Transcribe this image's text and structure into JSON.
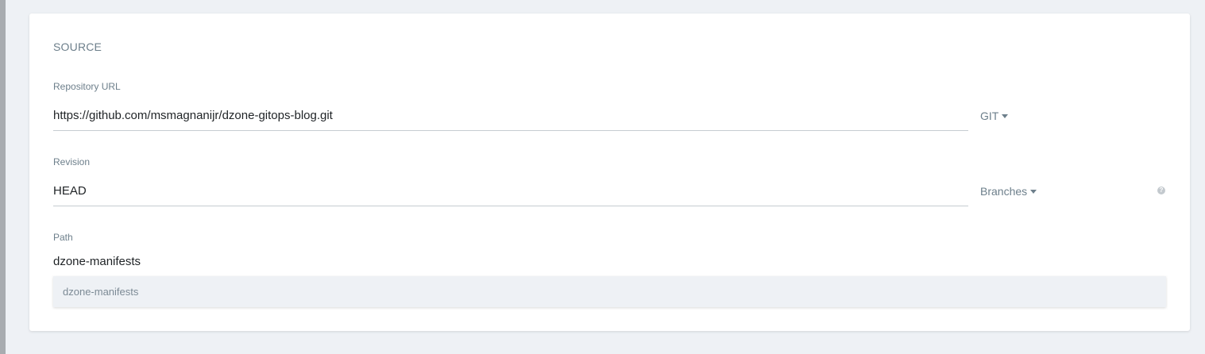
{
  "source": {
    "title": "SOURCE",
    "repository_url": {
      "label": "Repository URL",
      "value": "https://github.com/msmagnanijr/dzone-gitops-blog.git",
      "type_dropdown": "GIT"
    },
    "revision": {
      "label": "Revision",
      "value": "HEAD",
      "type_dropdown": "Branches",
      "help_icon": "?"
    },
    "path": {
      "label": "Path",
      "value": "dzone-manifests",
      "suggestions": [
        "dzone-manifests"
      ]
    }
  },
  "icons": {
    "dropdown_caret": "caret-down-icon",
    "help": "question-circle-icon"
  },
  "colors": {
    "background": "#eef1f5",
    "card": "#ffffff",
    "label": "#6d7f8b",
    "text": "#1f2326",
    "input_border": "#c6ccd1"
  }
}
